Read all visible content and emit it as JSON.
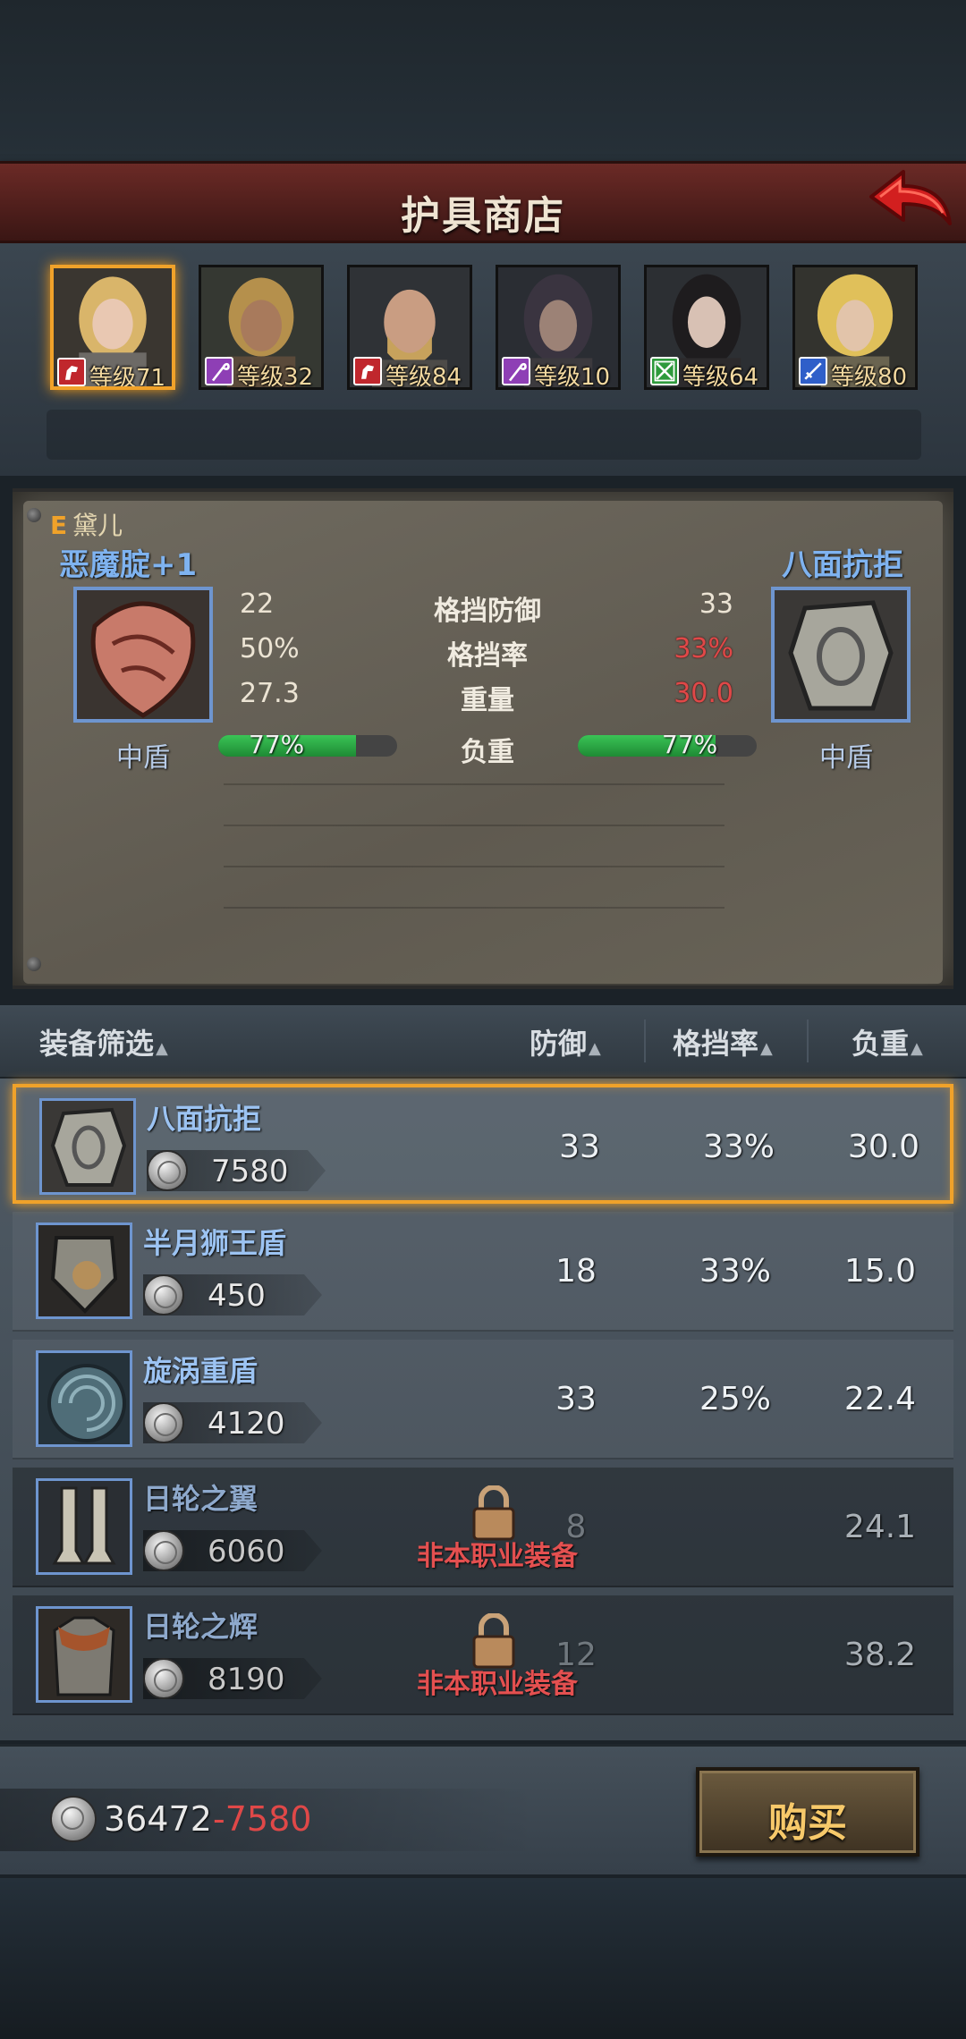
{
  "header": {
    "title": "护具商店",
    "back_icon": "red-back-arrow-icon"
  },
  "heroes": [
    {
      "level": "等级71",
      "class_icon": "horse-icon",
      "class_color": "#c0272d",
      "selected": true
    },
    {
      "level": "等级32",
      "class_icon": "staff-icon",
      "class_color": "#8e3fb5",
      "selected": false
    },
    {
      "level": "等级84",
      "class_icon": "horse-icon",
      "class_color": "#c0272d",
      "selected": false
    },
    {
      "level": "等级10",
      "class_icon": "staff-icon",
      "class_color": "#8e3fb5",
      "selected": false
    },
    {
      "level": "等级64",
      "class_icon": "crossed-swords-icon",
      "class_color": "#2e9a3c",
      "selected": false
    },
    {
      "level": "等级80",
      "class_icon": "sword-icon",
      "class_color": "#2f5fc9",
      "selected": false
    }
  ],
  "compare": {
    "owner_rank": "E",
    "owner_name": "黛儿",
    "current": {
      "name": "恶魔腚+1",
      "type": "中盾",
      "block_def": "22",
      "block_rate": "50%",
      "weight": "27.3",
      "load": "77%",
      "load_fraction": 0.77
    },
    "candidate": {
      "name": "八面抗拒",
      "type": "中盾",
      "block_def": "33",
      "block_rate": "33%",
      "weight": "30.0",
      "load": "77%",
      "load_fraction": 0.77
    },
    "labels": {
      "block_def": "格挡防御",
      "block_rate": "格挡率",
      "weight": "重量",
      "load": "负重"
    },
    "colors": {
      "worse": "#e04848"
    }
  },
  "list": {
    "headers": {
      "filter": "装备筛选",
      "defense": "防御",
      "block_rate": "格挡率",
      "load": "负重"
    },
    "sort_icon": "triangle-up-icon",
    "items": [
      {
        "name": "八面抗拒",
        "price": "7580",
        "defense": "33",
        "block_rate": "33%",
        "load": "30.0",
        "locked": false,
        "selected": true
      },
      {
        "name": "半月狮王盾",
        "price": "450",
        "defense": "18",
        "block_rate": "33%",
        "load": "15.0",
        "locked": false,
        "selected": false
      },
      {
        "name": "旋涡重盾",
        "price": "4120",
        "defense": "33",
        "block_rate": "25%",
        "load": "22.4",
        "locked": false,
        "selected": false
      },
      {
        "name": "日轮之翼",
        "price": "6060",
        "defense": "8",
        "block_rate": "",
        "load": "24.1",
        "locked": true,
        "lock_text": "非本职业装备",
        "selected": false
      },
      {
        "name": "日轮之辉",
        "price": "8190",
        "defense": "12",
        "block_rate": "",
        "load": "38.2",
        "locked": true,
        "lock_text": "非本职业装备",
        "selected": false
      }
    ]
  },
  "footer": {
    "money": "36472",
    "cost": "-7580",
    "buy_label": "购买"
  }
}
